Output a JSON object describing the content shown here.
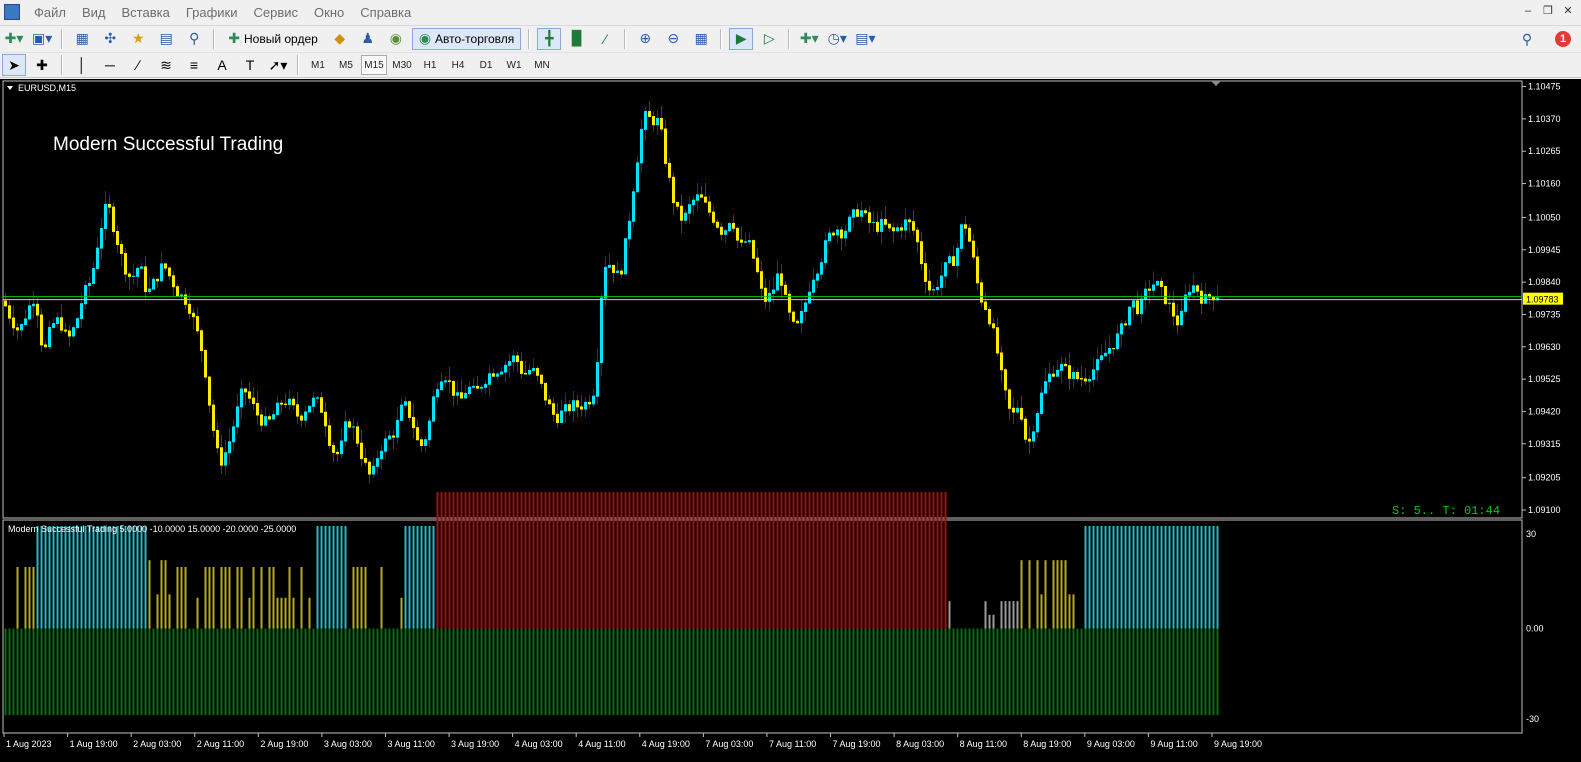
{
  "menu": {
    "items": [
      "Файл",
      "Вид",
      "Вставка",
      "Графики",
      "Сервис",
      "Окно",
      "Справка"
    ]
  },
  "toolbar": {
    "new_order_label": "Новый ордер",
    "autotrade_label": "Авто-торговля",
    "notification_count": "1"
  },
  "timeframes": [
    "M1",
    "M5",
    "M15",
    "M30",
    "H1",
    "H4",
    "D1",
    "W1",
    "MN"
  ],
  "active_timeframe": "M15",
  "chart": {
    "symbol_label": "EURUSD,M15",
    "watermark": "Modern Successful Trading",
    "status_text": "S: 5.. T: 01:44",
    "current_price": "1.09783",
    "price_ticks": [
      "1.10475",
      "1.10370",
      "1.10265",
      "1.10160",
      "1.10050",
      "1.09945",
      "1.09840",
      "1.09735",
      "1.09630",
      "1.09525",
      "1.09420",
      "1.09315",
      "1.09205",
      "1.09100"
    ],
    "time_ticks": [
      "1 Aug 2023",
      "1 Aug 19:00",
      "2 Aug 03:00",
      "2 Aug 11:00",
      "2 Aug 19:00",
      "3 Aug 03:00",
      "3 Aug 11:00",
      "3 Aug 19:00",
      "4 Aug 03:00",
      "4 Aug 11:00",
      "4 Aug 19:00",
      "7 Aug 03:00",
      "7 Aug 11:00",
      "7 Aug 19:00",
      "8 Aug 03:00",
      "8 Aug 11:00",
      "8 Aug 19:00",
      "9 Aug 03:00",
      "9 Aug 11:00",
      "9 Aug 19:00"
    ],
    "colors": {
      "up": "#00e5ff",
      "down": "#ffeb00",
      "wick_up": "#1a1aff",
      "wick_down": "#cc0000",
      "grid_line": "#00cc00",
      "price_tag": "#ffff00"
    }
  },
  "indicator": {
    "label": "Modern Successful Trading 5.0000 -10.0000 15.0000 -20.0000 -25.0000",
    "axis_ticks": [
      "30",
      "0.00",
      "-30"
    ],
    "colors": {
      "cyan": "#2fb4c4",
      "olive": "#b4a82a",
      "gray": "#9a9a9a",
      "red": "#a01010",
      "green": "#0e6b18"
    }
  },
  "chart_data": {
    "type": "candlestick",
    "symbol": "EURUSD",
    "timeframe": "M15",
    "ylim": [
      1.091,
      1.1048
    ],
    "price_path": [
      [
        0,
        1.0978
      ],
      [
        2,
        1.0972
      ],
      [
        4,
        1.0968
      ],
      [
        6,
        1.0975
      ],
      [
        8,
        1.098
      ],
      [
        10,
        1.096
      ],
      [
        12,
        1.097
      ],
      [
        14,
        1.0972
      ],
      [
        16,
        1.0965
      ],
      [
        18,
        1.097
      ],
      [
        20,
        1.098
      ],
      [
        22,
        1.0985
      ],
      [
        24,
        1.1
      ],
      [
        26,
        1.101
      ],
      [
        28,
        1.1
      ],
      [
        30,
        1.099
      ],
      [
        32,
        1.0985
      ],
      [
        34,
        1.099
      ],
      [
        36,
        1.098
      ],
      [
        38,
        1.0985
      ],
      [
        40,
        1.099
      ],
      [
        42,
        1.0985
      ],
      [
        44,
        1.098
      ],
      [
        46,
        1.0978
      ],
      [
        48,
        1.097
      ],
      [
        50,
        1.096
      ],
      [
        52,
        1.094
      ],
      [
        54,
        1.0925
      ],
      [
        56,
        1.093
      ],
      [
        58,
        1.094
      ],
      [
        60,
        1.095
      ],
      [
        62,
        1.0945
      ],
      [
        64,
        1.094
      ],
      [
        66,
        1.0938
      ],
      [
        68,
        1.0942
      ],
      [
        70,
        1.0946
      ],
      [
        72,
        1.0944
      ],
      [
        74,
        1.094
      ],
      [
        76,
        1.0944
      ],
      [
        78,
        1.0946
      ],
      [
        80,
        1.0942
      ],
      [
        82,
        1.093
      ],
      [
        84,
        1.0928
      ],
      [
        86,
        1.094
      ],
      [
        88,
        1.0935
      ],
      [
        90,
        1.0926
      ],
      [
        92,
        1.092
      ],
      [
        94,
        1.093
      ],
      [
        96,
        1.0933
      ],
      [
        98,
        1.0936
      ],
      [
        100,
        1.0945
      ],
      [
        102,
        1.094
      ],
      [
        104,
        1.093
      ],
      [
        106,
        1.0935
      ],
      [
        108,
        1.095
      ],
      [
        110,
        1.0955
      ],
      [
        112,
        1.095
      ],
      [
        114,
        1.0945
      ],
      [
        116,
        1.095
      ],
      [
        118,
        1.0948
      ],
      [
        120,
        1.0952
      ],
      [
        122,
        1.0955
      ],
      [
        124,
        1.0956
      ],
      [
        126,
        1.0958
      ],
      [
        128,
        1.096
      ],
      [
        130,
        1.0954
      ],
      [
        132,
        1.0956
      ],
      [
        134,
        1.0952
      ],
      [
        136,
        1.0945
      ],
      [
        138,
        1.094
      ],
      [
        140,
        1.0942
      ],
      [
        142,
        1.0944
      ],
      [
        144,
        1.0944
      ],
      [
        146,
        1.0945
      ],
      [
        148,
        1.095
      ],
      [
        150,
        1.099
      ],
      [
        152,
        1.099
      ],
      [
        154,
        1.0985
      ],
      [
        156,
        1.1
      ],
      [
        158,
        1.102
      ],
      [
        160,
        1.1038
      ],
      [
        162,
        1.1037
      ],
      [
        164,
        1.1036
      ],
      [
        166,
        1.102
      ],
      [
        168,
        1.1008
      ],
      [
        170,
        1.1004
      ],
      [
        172,
        1.101
      ],
      [
        174,
        1.1012
      ],
      [
        176,
        1.1008
      ],
      [
        178,
        1.1004
      ],
      [
        180,
        1.1
      ],
      [
        182,
        1.1006
      ],
      [
        184,
        1.0995
      ],
      [
        186,
        1.0998
      ],
      [
        188,
        1.099
      ],
      [
        190,
        1.0978
      ],
      [
        192,
        1.098
      ],
      [
        194,
        1.0988
      ],
      [
        196,
        1.0975
      ],
      [
        198,
        1.0968
      ],
      [
        200,
        1.0975
      ],
      [
        202,
        1.0985
      ],
      [
        204,
        1.099
      ],
      [
        206,
        1.0998
      ],
      [
        208,
        1.1002
      ],
      [
        210,
        1.1
      ],
      [
        212,
        1.1005
      ],
      [
        214,
        1.1008
      ],
      [
        216,
        1.1004
      ],
      [
        218,
        1.1002
      ],
      [
        220,
        1.1003
      ],
      [
        222,
        1.1
      ],
      [
        224,
        1.1002
      ],
      [
        226,
        1.1004
      ],
      [
        228,
        1.1
      ],
      [
        230,
        1.0988
      ],
      [
        232,
        1.098
      ],
      [
        234,
        1.0985
      ],
      [
        236,
        1.099
      ],
      [
        238,
        1.0992
      ],
      [
        240,
        1.1005
      ],
      [
        242,
        1.0995
      ],
      [
        244,
        1.098
      ],
      [
        246,
        1.0975
      ],
      [
        248,
        1.0965
      ],
      [
        250,
        1.095
      ],
      [
        252,
        1.094
      ],
      [
        254,
        1.0945
      ],
      [
        256,
        1.093
      ],
      [
        258,
        1.094
      ],
      [
        260,
        1.095
      ],
      [
        262,
        1.0955
      ],
      [
        264,
        1.0957
      ],
      [
        266,
        1.0955
      ],
      [
        268,
        1.0953
      ],
      [
        270,
        1.0953
      ],
      [
        272,
        1.0955
      ],
      [
        274,
        1.0958
      ],
      [
        276,
        1.0962
      ],
      [
        278,
        1.0965
      ],
      [
        280,
        1.097
      ],
      [
        282,
        1.0978
      ],
      [
        284,
        1.0975
      ],
      [
        286,
        1.0982
      ],
      [
        288,
        1.0984
      ],
      [
        290,
        1.098
      ],
      [
        292,
        1.0975
      ],
      [
        294,
        1.097
      ],
      [
        296,
        1.0982
      ],
      [
        298,
        1.0983
      ],
      [
        300,
        1.0978
      ],
      [
        302,
        1.098
      ]
    ],
    "indicator_series": {
      "ylim": [
        -30,
        30
      ],
      "segments": [
        {
          "from": 0,
          "to": 8,
          "pos": 18,
          "color": "olive"
        },
        {
          "from": 8,
          "to": 12,
          "pos": 30,
          "color": "cyan"
        },
        {
          "from": 12,
          "to": 36,
          "pos": 30,
          "color": "cyan"
        },
        {
          "from": 36,
          "to": 42,
          "pos": 20,
          "color": "olive"
        },
        {
          "from": 42,
          "to": 60,
          "pos": 18,
          "color": "olive"
        },
        {
          "from": 60,
          "to": 78,
          "pos": 18,
          "color": "olive"
        },
        {
          "from": 78,
          "to": 86,
          "pos": 30,
          "color": "cyan"
        },
        {
          "from": 86,
          "to": 100,
          "pos": 18,
          "color": "olive"
        },
        {
          "from": 100,
          "to": 108,
          "pos": 30,
          "color": "cyan"
        },
        {
          "from": 108,
          "to": 236,
          "pos": 40,
          "color": "red"
        },
        {
          "from": 236,
          "to": 254,
          "pos": 8,
          "color": "gray"
        },
        {
          "from": 254,
          "to": 270,
          "pos": 20,
          "color": "olive"
        },
        {
          "from": 270,
          "to": 304,
          "pos": 30,
          "color": "cyan"
        }
      ],
      "neg": -55,
      "neg_color": "green"
    }
  }
}
